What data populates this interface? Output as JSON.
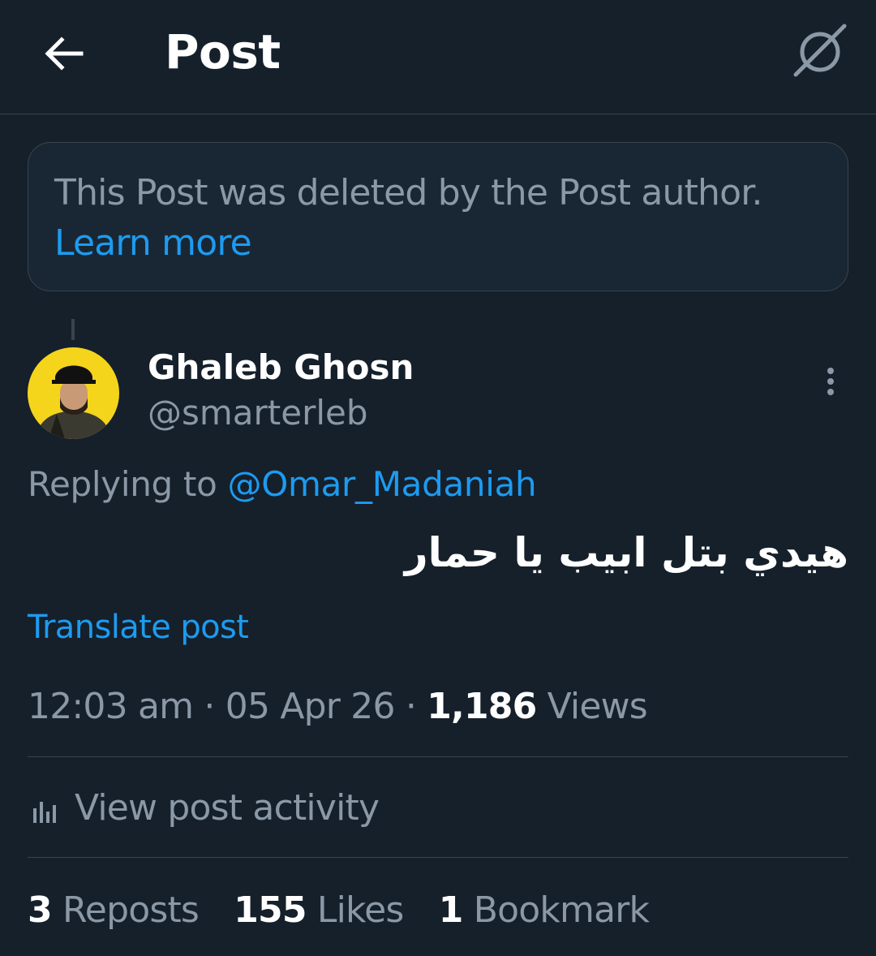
{
  "header": {
    "title": "Post",
    "back_icon": "arrow-left-icon",
    "grok_icon": "grok-icon"
  },
  "deleted_notice": {
    "text": "This Post was deleted by the Post author.",
    "link": "Learn more"
  },
  "post": {
    "author_name": "Ghaleb Ghosn",
    "author_handle": "@smarterleb",
    "replying_prefix": "Replying to",
    "replying_to": "@Omar_Madaniah",
    "text": "هيدي بتل ابيب يا حمار",
    "translate": "Translate post",
    "time": "12:03 am",
    "date": "05 Apr 26",
    "views_count": "1,186",
    "views_label": "Views",
    "activity_label": "View post activity"
  },
  "stats": {
    "reposts_count": "3",
    "reposts_label": "Reposts",
    "likes_count": "155",
    "likes_label": "Likes",
    "bookmarks_count": "1",
    "bookmarks_label": "Bookmark"
  },
  "colors": {
    "background": "#15202b",
    "accent": "#1d9bf0",
    "secondary_text": "#8b98a5",
    "border": "#38444d",
    "avatar_bg": "#f5d41c"
  }
}
